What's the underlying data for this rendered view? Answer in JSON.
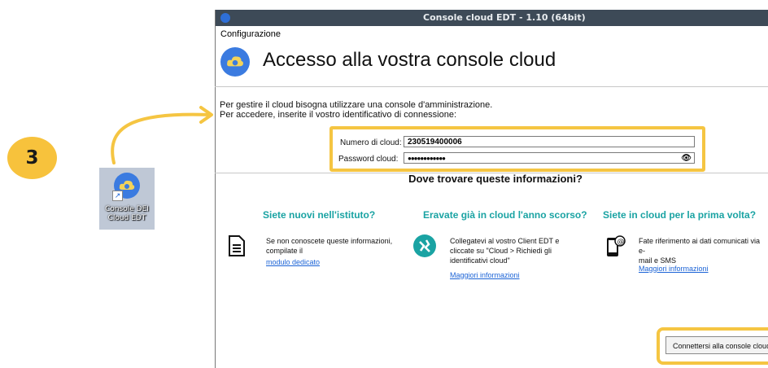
{
  "step": {
    "number": "3"
  },
  "desktop_icon": {
    "label_line1": "Console DEI",
    "label_line2": "Cloud EDT"
  },
  "window": {
    "title": "Console cloud EDT - 1.10 (64bit)"
  },
  "menu": {
    "item": "Configurazione"
  },
  "heading": {
    "title": "Accesso alla vostra console cloud"
  },
  "intro": {
    "line1": "Per gestire il cloud bisogna utilizzare una console d'amministrazione.",
    "line2": "Per accedere, inserite il vostro identificativo di connessione:"
  },
  "form": {
    "cloud_number_label": "Numero di cloud:",
    "cloud_number_value": "230519400006",
    "password_label": "Password cloud:",
    "password_value": "●●●●●●●●●●●●"
  },
  "info": {
    "title": "Dove trovare queste informazioni?",
    "columns": [
      {
        "title": "Siete nuovi nell'istituto?",
        "lines": [
          "Se non conoscete queste informazioni,",
          "compilate il"
        ],
        "link": "modulo dedicato",
        "icon": "document-icon"
      },
      {
        "title": "Eravate già in cloud l'anno scorso?",
        "lines": [
          "Collegatevi al vostro Client EDT e",
          "cliccate su \"Cloud > Richiedi gli",
          "identificativi cloud\""
        ],
        "link": "Maggiori informazioni",
        "icon": "globe-icon"
      },
      {
        "title": "Siete in cloud per la prima volta?",
        "lines": [
          "Fate riferimento ai dati comunicati via e-",
          "mail e SMS"
        ],
        "link": "Maggiori informazioni",
        "icon": "phone-email-icon"
      }
    ]
  },
  "connect_button": {
    "label": "Connettersi alla console cloud"
  },
  "colors": {
    "highlight": "#f5c542",
    "accent_teal": "#1aa3a3",
    "link": "#1b63d6",
    "titlebar": "#3d4a57"
  }
}
